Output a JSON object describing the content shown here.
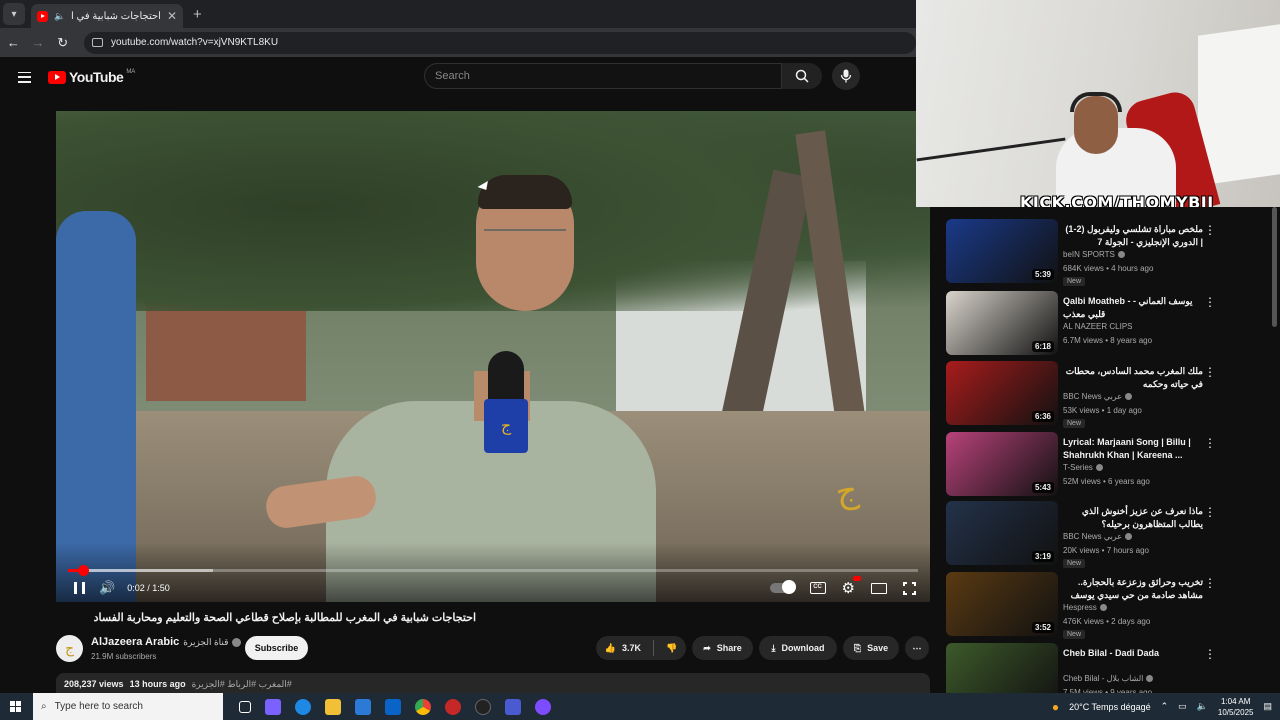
{
  "browser": {
    "tab_title": "احتجاجات شبابية في المغرب",
    "url": "youtube.com/watch?v=xjVN9KTL8KU"
  },
  "youtube": {
    "logo_text": "YouTube",
    "country_code": "MA",
    "search_placeholder": "Search"
  },
  "player": {
    "time": "0:02 / 1:50",
    "progress_fraction": 0.018,
    "buffered_fraction": 0.17
  },
  "video": {
    "title": "احتجاجات شبابية في المغرب للمطالبة بإصلاح قطاعي الصحة والتعليم ومحاربة الفساد",
    "channel_name": "AlJazeera Arabic",
    "channel_name_ar": "قناة الجزيرة",
    "subscribers": "21.9M subscribers",
    "subscribe_label": "Subscribe",
    "likes": "3.7K",
    "share_label": "Share",
    "download_label": "Download",
    "save_label": "Save",
    "views": "208,237 views",
    "age": "13 hours ago",
    "tags": "#المغرب #الرباط #الجزيرة"
  },
  "overlay": {
    "kick_text": "KICK.COM/THOMYBII"
  },
  "sidebar": {
    "items": [
      {
        "title": "ملخص مباراة تشلسي وليفربول (2-1) | الدوري الإنجليزي - الجولة 7",
        "rtl": true,
        "channel": "beIN SPORTS",
        "verified": true,
        "meta": "684K views • 4 hours ago",
        "new": "New",
        "duration": "5:39",
        "thumb_color": "#1a3a8a"
      },
      {
        "title": "Qalbi Moatheb - يوسف العماني - قلبي معذب",
        "rtl": false,
        "channel": "AL NAZEER CLIPS",
        "verified": false,
        "meta": "6.7M views • 8 years ago",
        "new": "",
        "duration": "6:18",
        "thumb_color": "#d9d4cc"
      },
      {
        "title": "ملك المغرب محمد السادس، محطات في حياته وحكمه",
        "rtl": true,
        "channel": "BBC News عربي",
        "verified": true,
        "meta": "53K views • 1 day ago",
        "new": "New",
        "duration": "6:36",
        "thumb_color": "#a81c1c"
      },
      {
        "title": "Lyrical: Marjaani Song | Billu | Shahrukh Khan | Kareena ...",
        "rtl": false,
        "channel": "T-Series",
        "verified": true,
        "meta": "52M views • 6 years ago",
        "new": "",
        "duration": "5:43",
        "thumb_color": "#b8427a"
      },
      {
        "title": "ماذا نعرف عن عزيز أخنوش الذي يطالب المتظاهرون برحيله؟",
        "rtl": true,
        "channel": "BBC News عربي",
        "verified": true,
        "meta": "20K views • 7 hours ago",
        "new": "New",
        "duration": "3:19",
        "thumb_color": "#23324a"
      },
      {
        "title": "تخريب وحرائق وزعزعة بالحجارة.. مشاهد صادمة من حي سيدي يوسف بن علي",
        "rtl": true,
        "channel": "Hespress",
        "verified": true,
        "meta": "476K views • 2 days ago",
        "new": "New",
        "duration": "3:52",
        "thumb_color": "#5a3a12"
      },
      {
        "title": "Cheb Bilal - Dadi Dada",
        "rtl": false,
        "channel": "Cheb Bilal - الشاب بلال",
        "verified": true,
        "meta": "7.5M views • 9 years ago",
        "new": "",
        "duration": "",
        "thumb_color": "#3d5a2a"
      }
    ]
  },
  "taskbar": {
    "search_placeholder": "Type here to search",
    "weather": "20°C  Temps dégagé",
    "time": "1:04 AM",
    "date": "10/5/2025"
  }
}
